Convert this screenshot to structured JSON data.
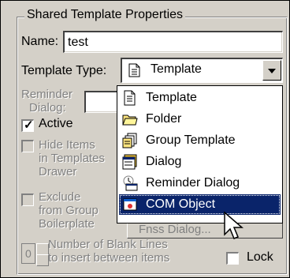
{
  "group": {
    "title": "Shared Template Properties"
  },
  "name_field": {
    "label": "Name:",
    "value": "test"
  },
  "template_type": {
    "label": "Template Type:",
    "selected": "Template",
    "options": [
      {
        "label": "Template",
        "icon": "document-icon"
      },
      {
        "label": "Folder",
        "icon": "folder-icon"
      },
      {
        "label": "Group Template",
        "icon": "group-template-icon"
      },
      {
        "label": "Dialog",
        "icon": "dialog-icon"
      },
      {
        "label": "Reminder Dialog",
        "icon": "reminder-dialog-icon"
      },
      {
        "label": "COM Object",
        "icon": "com-object-icon"
      }
    ],
    "highlighted_index": 5
  },
  "reminder_dialog": {
    "label_line1": "Reminder",
    "label_line2": "Dialog:"
  },
  "active": {
    "label": "Active",
    "checked": true
  },
  "hide_items": {
    "line1": "Hide Items",
    "line2": "in Templates",
    "line3": "Drawer"
  },
  "exclude": {
    "line1": "Exclude",
    "line2": "from Group",
    "line3": "Boilerplate"
  },
  "partial_button": {
    "label": "Fnss Dialog..."
  },
  "blank_lines": {
    "value": "0",
    "line1": "Number of Blank Lines",
    "line2": "to insert between items"
  },
  "lock": {
    "label": "Lock",
    "checked": false
  }
}
